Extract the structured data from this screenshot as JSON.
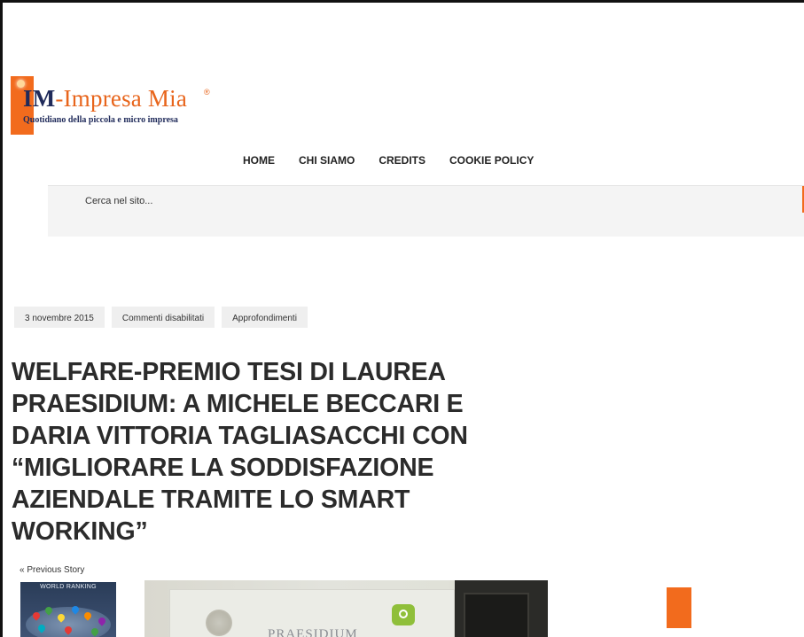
{
  "brand": {
    "name_im": "IM",
    "name_rest": "-Impresa Mia",
    "registered": "®",
    "tagline": "Quotidiano della piccola e micro impresa",
    "accent_color": "#f26b1d",
    "navy_color": "#1f2a5a"
  },
  "nav": {
    "items": [
      "HOME",
      "CHI SIAMO",
      "CREDITS",
      "COOKIE POLICY"
    ]
  },
  "search": {
    "placeholder": "Cerca nel sito..."
  },
  "article": {
    "meta": {
      "date": "3 novembre 2015",
      "comments": "Commenti disabilitati",
      "category": "Approfondimenti"
    },
    "title": "WELFARE-PREMIO TESI DI LAUREA PRAESIDIUM: A MICHELE BECCARI E DARIA VITTORIA TAGLIASACCHI CON “MIGLIORARE LA SODDISFAZIONE AZIENDALE TRAMITE LO SMART WORKING”",
    "prev_story": "« Previous Story"
  },
  "thumbnails": {
    "small_caption": "WORLD RANKING",
    "main_caption": "PRAESIDIUM"
  }
}
